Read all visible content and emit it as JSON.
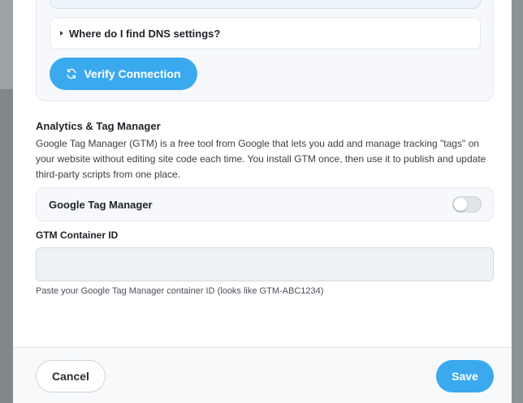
{
  "dns": {
    "help_accordion_label": "Where do I find DNS settings?",
    "verify_button_label": "Verify Connection"
  },
  "analytics": {
    "title": "Analytics & Tag Manager",
    "description": "Google Tag Manager (GTM) is a free tool from Google that lets you add and manage tracking \"tags\" on your website without editing site code each time. You install GTM once, then use it to publish and update third-party scripts from one place.",
    "gtm_toggle_label": "Google Tag Manager",
    "gtm_toggle_on": false,
    "container_id_label": "GTM Container ID",
    "container_id_value": "",
    "container_id_help": "Paste your Google Tag Manager container ID (looks like GTM-ABC1234)"
  },
  "footer": {
    "cancel_label": "Cancel",
    "save_label": "Save"
  },
  "colors": {
    "accent": "#3aa9ee",
    "overlay": "#8a9395"
  },
  "icons": {
    "verify": "refresh-icon",
    "accordion": "caret-right-icon"
  }
}
